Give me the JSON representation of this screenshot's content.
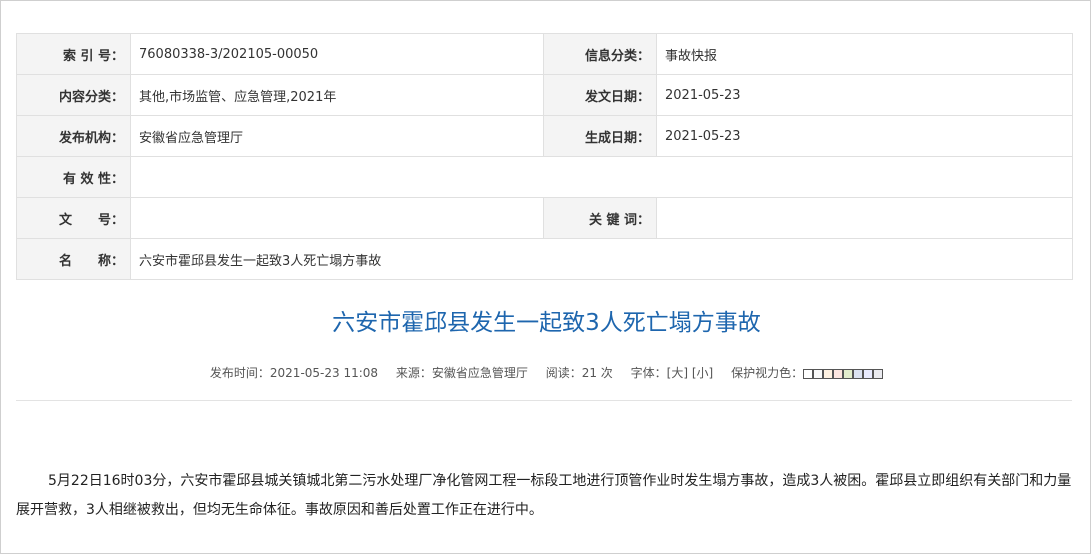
{
  "meta": {
    "index_label": "索 引 号：",
    "index_value": "76080338-3/202105-00050",
    "category_label": "信息分类：",
    "category_value": "事故快报",
    "content_class_label": "内容分类：",
    "content_class_value": "其他,市场监管、应急管理,2021年",
    "issue_date_label": "发文日期：",
    "issue_date_value": "2021-05-23",
    "publisher_label": "发布机构：",
    "publisher_value": "安徽省应急管理厅",
    "gen_date_label": "生成日期：",
    "gen_date_value": "2021-05-23",
    "validity_label": "有 效 性：",
    "validity_value": "",
    "doc_no_label": "文　　号：",
    "doc_no_value": "",
    "keywords_label": "关 键 词：",
    "keywords_value": "",
    "name_label": "名　　称：",
    "name_value": "六安市霍邱县发生一起致3人死亡塌方事故"
  },
  "article": {
    "title": "六安市霍邱县发生一起致3人死亡塌方事故",
    "publish_time": "发布时间：2021-05-23 11:08",
    "source": "来源：安徽省应急管理厅",
    "reads": "阅读：21 次",
    "font_label": "字体：",
    "font_large": "[大]",
    "font_small": "[小]",
    "eye_color_label": "保护视力色：",
    "swatch_colors": [
      "#ffffff",
      "#fafafa",
      "#fff2e2",
      "#fde6e0",
      "#e3edcd",
      "#dce2f1",
      "#e9ebfe",
      "#eaeaef"
    ],
    "body": "5月22日16时03分，六安市霍邱县城关镇城北第二污水处理厂净化管网工程一标段工地进行顶管作业时发生塌方事故，造成3人被困。霍邱县立即组织有关部门和力量展开营救，3人相继被救出，但均无生命体征。事故原因和善后处置工作正在进行中。"
  }
}
